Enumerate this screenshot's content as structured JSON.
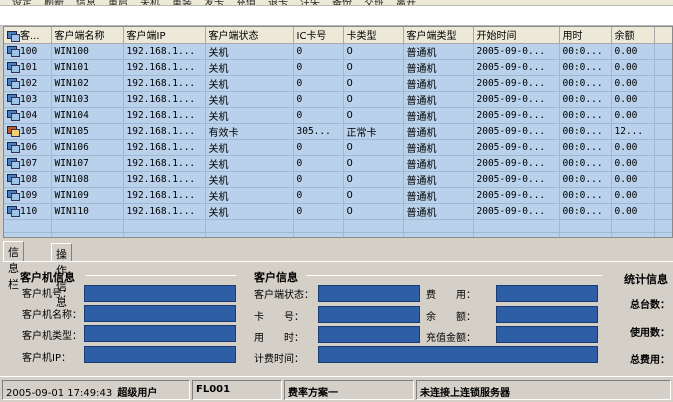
{
  "menu": {
    "items": [
      "设定",
      "刷新",
      "信息",
      "重启",
      "关机",
      "重装",
      "发卡",
      "充值",
      "退卡",
      "注失",
      "备份",
      "交班",
      "离开"
    ]
  },
  "grid": {
    "columns": [
      "客...",
      "客户端名称",
      "客户端IP",
      "客户端状态",
      "IC卡号",
      "卡类型",
      "客户端类型",
      "开始时间",
      "用时",
      "余额"
    ],
    "rows": [
      {
        "id": "100",
        "name": "WIN100",
        "ip": "192.168.1...",
        "status": "关机",
        "ic": "0",
        "card_type": "0",
        "client_type": "普通机",
        "start": "2005-09-0...",
        "used": "00:0...",
        "balance": "0.00",
        "active": false
      },
      {
        "id": "101",
        "name": "WIN101",
        "ip": "192.168.1...",
        "status": "关机",
        "ic": "0",
        "card_type": "0",
        "client_type": "普通机",
        "start": "2005-09-0...",
        "used": "00:0...",
        "balance": "0.00",
        "active": false
      },
      {
        "id": "102",
        "name": "WIN102",
        "ip": "192.168.1...",
        "status": "关机",
        "ic": "0",
        "card_type": "0",
        "client_type": "普通机",
        "start": "2005-09-0...",
        "used": "00:0...",
        "balance": "0.00",
        "active": false
      },
      {
        "id": "103",
        "name": "WIN103",
        "ip": "192.168.1...",
        "status": "关机",
        "ic": "0",
        "card_type": "0",
        "client_type": "普通机",
        "start": "2005-09-0...",
        "used": "00:0...",
        "balance": "0.00",
        "active": false
      },
      {
        "id": "104",
        "name": "WIN104",
        "ip": "192.168.1...",
        "status": "关机",
        "ic": "0",
        "card_type": "0",
        "client_type": "普通机",
        "start": "2005-09-0...",
        "used": "00:0...",
        "balance": "0.00",
        "active": false
      },
      {
        "id": "105",
        "name": "WIN105",
        "ip": "192.168.1...",
        "status": "有效卡",
        "ic": "305...",
        "card_type": "正常卡",
        "client_type": "普通机",
        "start": "2005-09-0...",
        "used": "00:0...",
        "balance": "12...",
        "active": true
      },
      {
        "id": "106",
        "name": "WIN106",
        "ip": "192.168.1...",
        "status": "关机",
        "ic": "0",
        "card_type": "0",
        "client_type": "普通机",
        "start": "2005-09-0...",
        "used": "00:0...",
        "balance": "0.00",
        "active": false
      },
      {
        "id": "107",
        "name": "WIN107",
        "ip": "192.168.1...",
        "status": "关机",
        "ic": "0",
        "card_type": "0",
        "client_type": "普通机",
        "start": "2005-09-0...",
        "used": "00:0...",
        "balance": "0.00",
        "active": false
      },
      {
        "id": "108",
        "name": "WIN108",
        "ip": "192.168.1...",
        "status": "关机",
        "ic": "0",
        "card_type": "0",
        "client_type": "普通机",
        "start": "2005-09-0...",
        "used": "00:0...",
        "balance": "0.00",
        "active": false
      },
      {
        "id": "109",
        "name": "WIN109",
        "ip": "192.168.1...",
        "status": "关机",
        "ic": "0",
        "card_type": "0",
        "client_type": "普通机",
        "start": "2005-09-0...",
        "used": "00:0...",
        "balance": "0.00",
        "active": false
      },
      {
        "id": "110",
        "name": "WIN110",
        "ip": "192.168.1...",
        "status": "关机",
        "ic": "0",
        "card_type": "0",
        "client_type": "普通机",
        "start": "2005-09-0...",
        "used": "00:0...",
        "balance": "0.00",
        "active": false
      }
    ]
  },
  "tabs": [
    "信息栏",
    "操作信息"
  ],
  "client_info": {
    "title": "客户机信息",
    "number": "客户机号：",
    "name": "客户机名称：",
    "type": "客户机类型：",
    "ip": "客户机IP："
  },
  "customer_info": {
    "title": "客户信息",
    "status": "客户端状态：",
    "card": "卡　　号：",
    "time_used": "用　　时：",
    "billing_time": "计费时间：",
    "fee": "费　　用：",
    "balance": "余　　额：",
    "recharge": "充值金额："
  },
  "stats": {
    "title": "统计信息",
    "total_machines": "总台数：",
    "in_use": "使用数：",
    "total_fee": "总费用："
  },
  "status": {
    "datetime": "2005-09-01 17:49:43",
    "user": "超级用户",
    "code": "FL001",
    "plan": "费率方案一",
    "server": "未连接上连锁服务器"
  }
}
